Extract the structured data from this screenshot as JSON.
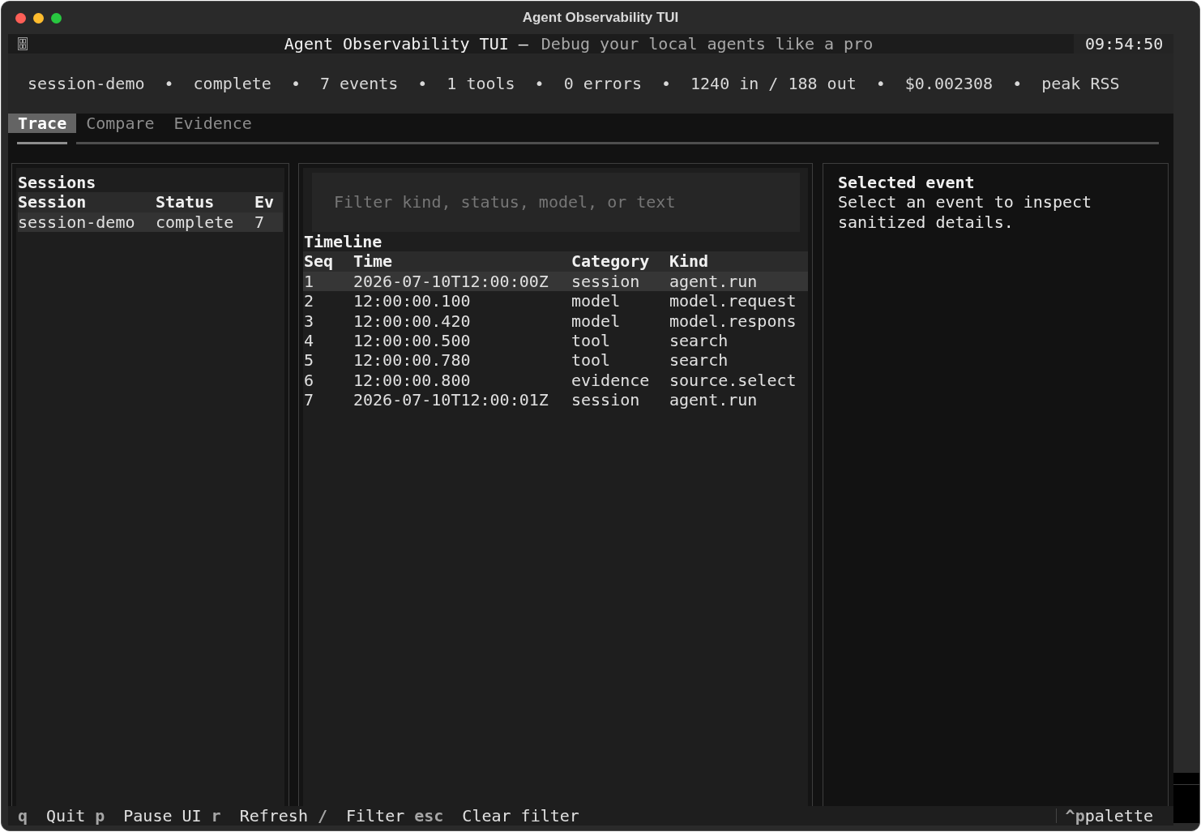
{
  "window": {
    "title": "Agent Observability TUI"
  },
  "header": {
    "title": "Agent Observability TUI",
    "separator": "—",
    "subtitle": "Debug your local agents like a pro",
    "clock": "09:54:50"
  },
  "stats": {
    "separator": "•",
    "items": [
      "session-demo",
      "complete",
      "7 events",
      "1 tools",
      "0 errors",
      "1240 in / 188 out",
      "$0.002308",
      "peak RSS"
    ]
  },
  "tabs": [
    {
      "label": "Trace",
      "selected": true
    },
    {
      "label": "Compare",
      "selected": false
    },
    {
      "label": "Evidence",
      "selected": false
    }
  ],
  "sessions_panel": {
    "title": "Sessions",
    "columns": [
      "Session",
      "Status",
      "Ev"
    ],
    "rows": [
      {
        "cells": [
          "session-demo",
          "complete",
          "7"
        ],
        "selected": true
      }
    ]
  },
  "timeline_panel": {
    "filter": {
      "placeholder": "Filter kind, status, model, or text"
    },
    "title": "Timeline",
    "columns": [
      "Seq",
      "Time",
      "Category",
      "Kind"
    ],
    "rows": [
      {
        "cells": [
          "1",
          "2026-07-10T12:00:00Z",
          "session",
          "agent.run"
        ],
        "selected": true
      },
      {
        "cells": [
          "2",
          "12:00:00.100",
          "model",
          "model.request"
        ],
        "selected": false
      },
      {
        "cells": [
          "3",
          "12:00:00.420",
          "model",
          "model.respons"
        ],
        "selected": false
      },
      {
        "cells": [
          "4",
          "12:00:00.500",
          "tool",
          "search"
        ],
        "selected": false
      },
      {
        "cells": [
          "5",
          "12:00:00.780",
          "tool",
          "search"
        ],
        "selected": false
      },
      {
        "cells": [
          "6",
          "12:00:00.800",
          "evidence",
          "source.select"
        ],
        "selected": false
      },
      {
        "cells": [
          "7",
          "2026-07-10T12:00:01Z",
          "session",
          "agent.run"
        ],
        "selected": false
      }
    ]
  },
  "detail_panel": {
    "title": "Selected event",
    "body": "Select an event to inspect sanitized details."
  },
  "footer": {
    "bindings": [
      {
        "key": "q",
        "label": "Quit"
      },
      {
        "key": "p",
        "label": "Pause UI"
      },
      {
        "key": "r",
        "label": "Refresh"
      },
      {
        "key": "/",
        "label": "Filter"
      },
      {
        "key": "esc",
        "label": "Clear filter"
      }
    ],
    "palette": {
      "key": "^p",
      "label": "palette"
    }
  }
}
